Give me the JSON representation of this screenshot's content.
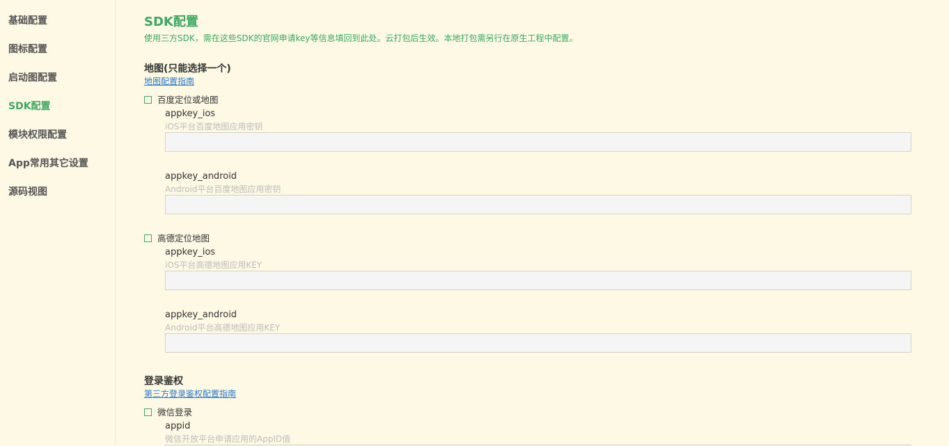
{
  "sidebar": {
    "items": [
      {
        "label": "基础配置"
      },
      {
        "label": "图标配置"
      },
      {
        "label": "启动图配置"
      },
      {
        "label": "SDK配置",
        "active": true
      },
      {
        "label": "模块权限配置"
      },
      {
        "label": "App常用其它设置"
      },
      {
        "label": "源码视图"
      }
    ]
  },
  "main": {
    "title": "SDK配置",
    "description": "使用三方SDK，需在这些SDK的官网申请key等信息填回到此处。云打包后生效。本地打包需另行在原生工程中配置。",
    "map_section": {
      "title": "地图(只能选择一个)",
      "guide_link": "地图配置指南",
      "providers": [
        {
          "name": "百度定位或地图",
          "checked": false,
          "fields": [
            {
              "label": "appkey_ios",
              "hint": "iOS平台百度地图应用密钥",
              "value": ""
            },
            {
              "label": "appkey_android",
              "hint": "Android平台百度地图应用密钥",
              "value": ""
            }
          ]
        },
        {
          "name": "高德定位地图",
          "checked": false,
          "fields": [
            {
              "label": "appkey_ios",
              "hint": "iOS平台高德地图应用KEY",
              "value": ""
            },
            {
              "label": "appkey_android",
              "hint": "Android平台高德地图应用KEY",
              "value": ""
            }
          ]
        }
      ]
    },
    "login_section": {
      "title": "登录鉴权",
      "guide_link": "第三方登录鉴权配置指南",
      "providers": [
        {
          "name": "微信登录",
          "checked": false,
          "fields": [
            {
              "label": "appid",
              "hint": "微信开放平台申请应用的AppID值",
              "value": ""
            }
          ]
        }
      ]
    }
  },
  "colors": {
    "background": "#fdf9e4",
    "accent": "#3ea862",
    "link": "#2a79c9",
    "hint": "#bdbdbd",
    "input_bg": "#f5f5f5",
    "input_border": "#d7d2bf"
  }
}
